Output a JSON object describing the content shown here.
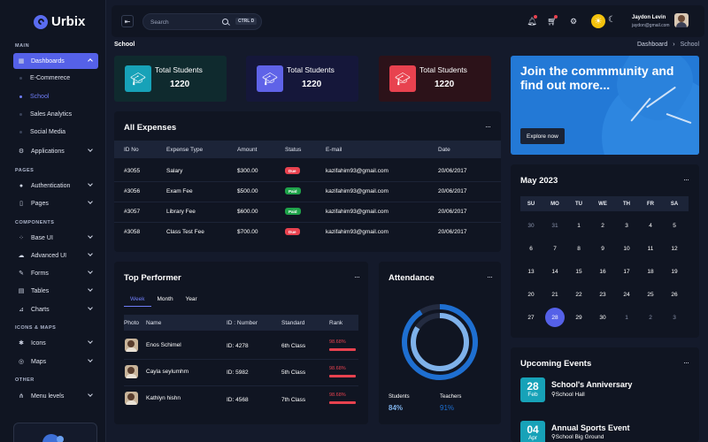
{
  "app": {
    "name": "Urbix"
  },
  "sidebar": {
    "sections": {
      "main": "MAIN",
      "pages": "PAGES",
      "components": "COMPONENTS",
      "icons_maps": "ICONS & MAPS",
      "other": "OTHER"
    },
    "dashboards": "Dashboards",
    "sub_items": [
      "E-Commerece",
      "School",
      "Sales Analytics",
      "Social Media"
    ],
    "applications": "Applications",
    "authentication": "Authentication",
    "pages": "Pages",
    "base_ui": "Base UI",
    "advanced_ui": "Advanced UI",
    "forms": "Forms",
    "tables": "Tables",
    "charts": "Charts",
    "icons": "Icons",
    "maps": "Maps",
    "menu_levels": "Menu levels"
  },
  "header": {
    "search_placeholder": "Search",
    "shortcut": "CTRL D",
    "user_name": "Jaydon Levin",
    "user_email": "jaydon@gmail.com"
  },
  "page": {
    "title": "School",
    "breadcrumb": [
      "Dashboard",
      "School"
    ]
  },
  "stats": [
    {
      "label": "Total Students",
      "value": "1220"
    },
    {
      "label": "Total Students",
      "value": "1220"
    },
    {
      "label": "Total Students",
      "value": "1220"
    }
  ],
  "colors": {
    "accent": "#5561e8",
    "teal": "#17a2b8",
    "purple": "#5f63e8",
    "red": "#e8424f",
    "green": "#1fa34a",
    "blue_promo": "#2379d6"
  },
  "expenses": {
    "title": "All Expenses",
    "columns": [
      "ID No",
      "Expense Type",
      "Amount",
      "Status",
      "E-mail",
      "Date"
    ],
    "rows": [
      {
        "id": "#3055",
        "type": "Salary",
        "amount": "$300.00",
        "status": "Due",
        "email": "kazifahim93@gmail.com",
        "date": "20/06/2017"
      },
      {
        "id": "#3056",
        "type": "Exam Fee",
        "amount": "$500.00",
        "status": "Paid",
        "email": "kazifahim93@gmail.com",
        "date": "20/06/2017"
      },
      {
        "id": "#3057",
        "type": "Library Fee",
        "amount": "$600.00",
        "status": "Paid",
        "email": "kazifahim93@gmail.com",
        "date": "20/06/2017"
      },
      {
        "id": "#3058",
        "type": "Class Test Fee",
        "amount": "$700.00",
        "status": "Due",
        "email": "kazifahim93@gmail.com",
        "date": "20/06/2017"
      }
    ]
  },
  "promo": {
    "title": "Join the commmunity and find out more...",
    "button": "Explore now"
  },
  "calendar": {
    "title": "May 2023",
    "weekdays": [
      "SU",
      "MO",
      "TU",
      "WE",
      "TH",
      "FR",
      "SA"
    ],
    "weeks": [
      [
        "30",
        "31",
        "1",
        "2",
        "3",
        "4",
        "5"
      ],
      [
        "6",
        "7",
        "8",
        "9",
        "10",
        "11",
        "12"
      ],
      [
        "13",
        "14",
        "15",
        "16",
        "17",
        "18",
        "19"
      ],
      [
        "20",
        "21",
        "22",
        "23",
        "24",
        "25",
        "26"
      ],
      [
        "27",
        "28",
        "29",
        "30",
        "1",
        "2",
        "3"
      ]
    ],
    "selected": "28"
  },
  "performer": {
    "title": "Top Performer",
    "tabs": [
      "Week",
      "Month",
      "Year"
    ],
    "columns": [
      "Photo",
      "Name",
      "ID : Number",
      "Standard",
      "Rank"
    ],
    "rows": [
      {
        "name": "Enos Schimel",
        "id": "ID: 4278",
        "standard": "6th Class",
        "rank": "98.68%"
      },
      {
        "name": "Cayla seylumhm",
        "id": "ID: 5982",
        "standard": "5th Class",
        "rank": "98.68%"
      },
      {
        "name": "Kathlyn hishn",
        "id": "ID: 4568",
        "standard": "7th Class",
        "rank": "98.68%"
      }
    ]
  },
  "attendance": {
    "title": "Attendance",
    "students_label": "Students",
    "teachers_label": "Teachers",
    "students_value": "84%",
    "teachers_value": "91%",
    "students_fraction": 0.84,
    "teachers_fraction": 0.91
  },
  "events": {
    "title": "Upcoming Events",
    "items": [
      {
        "day": "28",
        "month": "Feb",
        "title": "School's Anniversary",
        "location": "School Hall"
      },
      {
        "day": "04",
        "month": "Apr",
        "title": "Annual Sports Event",
        "location": "School Big Ground"
      }
    ]
  }
}
